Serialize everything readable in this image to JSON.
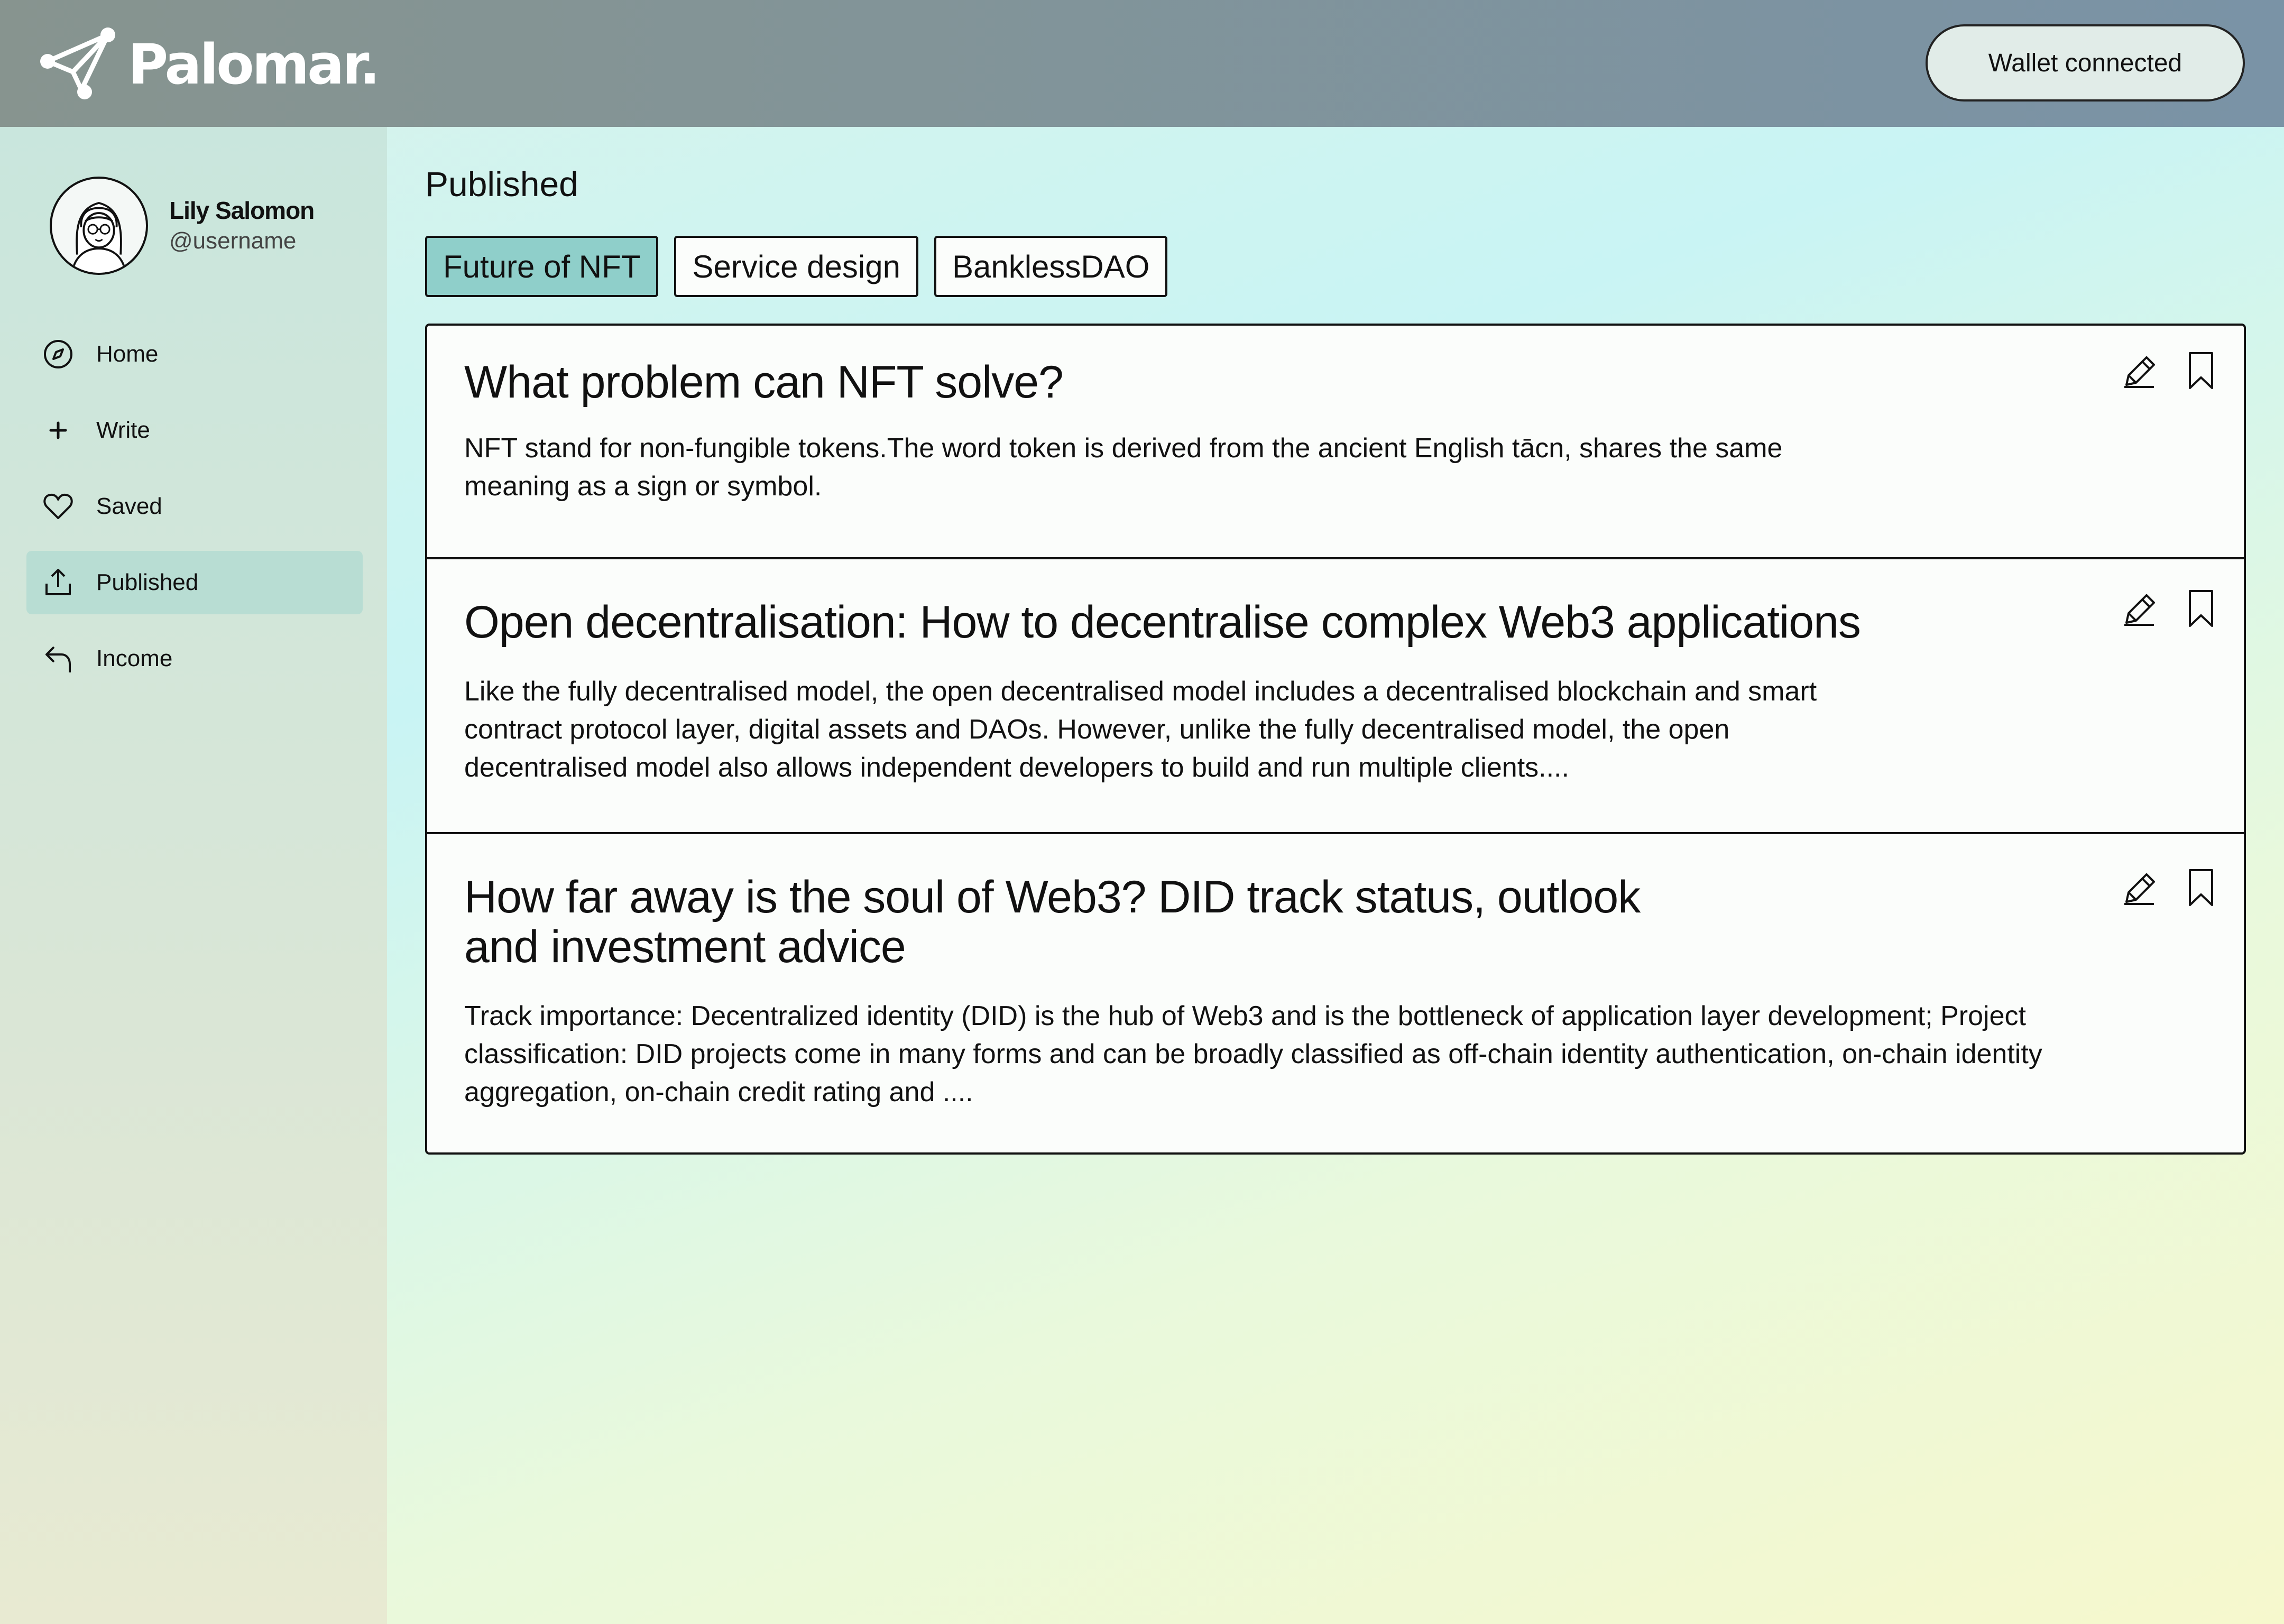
{
  "header": {
    "brand": "Palomar.",
    "wallet_button": "Wallet connected"
  },
  "profile": {
    "name": "Lily Salomon",
    "handle": "@username"
  },
  "sidebar": {
    "items": [
      {
        "label": "Home",
        "icon": "compass-icon"
      },
      {
        "label": "Write",
        "icon": "plus-icon"
      },
      {
        "label": "Saved",
        "icon": "heart-icon"
      },
      {
        "label": "Published",
        "icon": "upload-icon",
        "active": true
      },
      {
        "label": "Income",
        "icon": "reply-arrow-icon"
      }
    ]
  },
  "main": {
    "title": "Published",
    "tabs": [
      {
        "label": "Future of NFT",
        "active": true
      },
      {
        "label": "Service design"
      },
      {
        "label": "BanklessDAO"
      }
    ],
    "posts": [
      {
        "title": "What problem can NFT solve?",
        "excerpt": "NFT stand for non-fungible tokens.The word token is derived from the ancient English tācn, shares the same meaning as a sign or symbol."
      },
      {
        "title": "Open decentralisation: How to decentralise complex Web3 applications",
        "excerpt": "Like the fully decentralised model, the open decentralised model includes a decentralised blockchain and smart contract protocol layer, digital assets and DAOs. However, unlike the fully decentralised model, the open decentralised model also allows independent developers to build and run multiple clients...."
      },
      {
        "title": "How far away is the soul of Web3? DID track status, outlook and investment advice",
        "excerpt": "Track importance: Decentralized identity (DID) is the hub of Web3 and is the bottleneck of application layer development; Project classification: DID projects come in many forms and can be broadly classified as off-chain identity authentication, on-chain identity aggregation, on-chain credit rating and ...."
      }
    ]
  },
  "colors": {
    "active_tab": "#8fcfca",
    "active_nav": "#b8ddd3",
    "header_start": "#87948f",
    "header_end": "#7a93a6"
  }
}
